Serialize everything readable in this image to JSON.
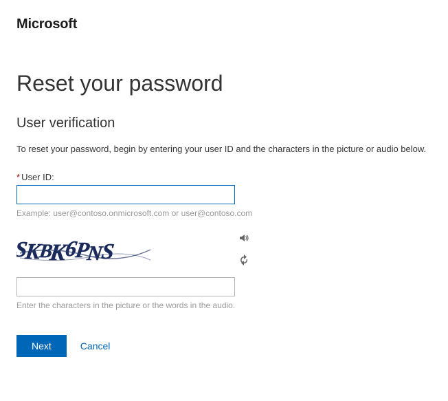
{
  "brand": "Microsoft",
  "page_title": "Reset your password",
  "subheading": "User verification",
  "instruction": "To reset your password, begin by entering your user ID and the characters in the picture or audio below.",
  "user_id": {
    "required_mark": "*",
    "label": "User ID:",
    "value": "",
    "example": "Example: user@contoso.onmicrosoft.com or user@contoso.com"
  },
  "captcha": {
    "image_text": "SKBK6PNS",
    "input_value": "",
    "hint": "Enter the characters in the picture or the words in the audio.",
    "audio_icon": "audio-icon",
    "refresh_icon": "refresh-icon"
  },
  "buttons": {
    "next": "Next",
    "cancel": "Cancel"
  },
  "colors": {
    "primary": "#0067b8",
    "required": "#a80000",
    "hint": "#999999"
  }
}
